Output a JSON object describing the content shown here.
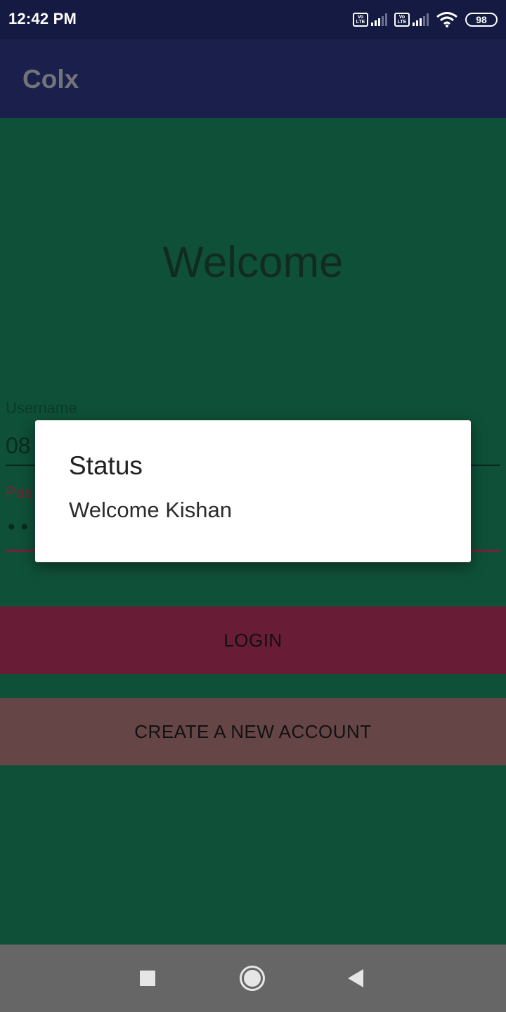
{
  "status_bar": {
    "time": "12:42 PM",
    "volte_1": "Vo LTE",
    "volte_2": "Vo LTE",
    "battery": "98"
  },
  "app_bar": {
    "title": "Colx"
  },
  "main": {
    "welcome": "Welcome",
    "username_label": "Username",
    "username_value": "08",
    "password_label": "Pas",
    "password_value": "••••",
    "login_button": "LOGIN",
    "create_account_button": "CREATE A NEW ACCOUNT"
  },
  "dialog": {
    "title": "Status",
    "message": "Welcome Kishan"
  },
  "colors": {
    "status_bar": "#141a42",
    "app_bar": "#1b1f4c",
    "background": "#0f5138",
    "login_button": "#691c36",
    "create_button": "#664547",
    "nav_bar": "#666666"
  },
  "icons": {
    "signal": "signal-icon",
    "wifi": "wifi-icon",
    "battery": "battery-icon",
    "recents": "square-icon",
    "home": "circle-icon",
    "back": "triangle-back-icon"
  }
}
